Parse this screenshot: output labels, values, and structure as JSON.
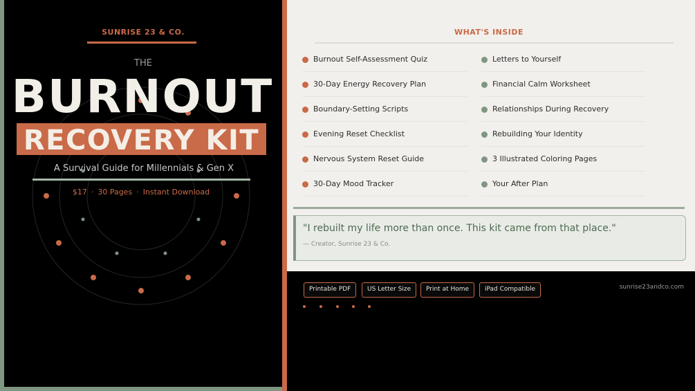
{
  "cover": {
    "brand": "SUNRISE 23 & CO.",
    "the": "THE",
    "title_main": "BURNOUT",
    "title_sub": "RECOVERY KIT",
    "tagline": "A Survival Guide for Millennials & Gen X",
    "meta": {
      "price": "$17",
      "pages": "30 Pages",
      "delivery": "Instant Download",
      "separator": "·"
    }
  },
  "colors": {
    "accent": "#c96a48",
    "sage": "#7f9682",
    "cream": "#f2f0ec",
    "black": "#000000"
  },
  "contents": {
    "title": "WHAT'S INSIDE",
    "left_items": [
      "Burnout Self-Assessment Quiz",
      "30-Day Energy Recovery Plan",
      "Boundary-Setting Scripts",
      "Evening Reset Checklist",
      "Nervous System Reset Guide",
      "30-Day Mood Tracker"
    ],
    "right_items": [
      "Letters to Yourself",
      "Financial Calm Worksheet",
      "Relationships During Recovery",
      "Rebuilding Your Identity",
      "3 Illustrated Coloring Pages",
      "Your After Plan"
    ]
  },
  "quote": {
    "text": "\"I rebuilt my life more than once. This kit came from that place.\"",
    "attribution": "— Creator, Sunrise 23 & Co."
  },
  "footer": {
    "badges": [
      "Printable PDF",
      "US Letter Size",
      "Print at Home",
      "iPad Compatible"
    ],
    "website": "sunrise23andco.com"
  }
}
